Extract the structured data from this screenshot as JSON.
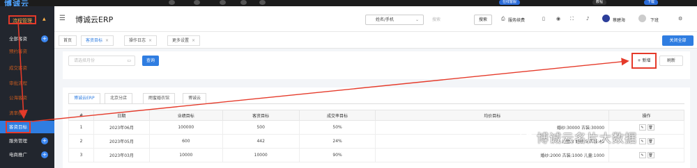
{
  "topbar": {
    "logo": "博诚云",
    "buttons": [
      "在线客服",
      "教程",
      "下载"
    ]
  },
  "sidebar": {
    "group": "流程管理",
    "items": [
      {
        "label": "全部客资",
        "plus": true
      },
      {
        "label": "预约客资"
      },
      {
        "label": "成交客资"
      },
      {
        "label": "审批流程"
      },
      {
        "label": "公海客资"
      },
      {
        "label": "清率统计"
      },
      {
        "label": "客资目标",
        "active": true
      },
      {
        "label": "服务管理",
        "plus": true
      },
      {
        "label": "电商推广",
        "plus": true
      }
    ]
  },
  "header": {
    "brand": "博诚云ERP",
    "select": "姓名/手机",
    "search_placeholder": "搜索",
    "search_button": "搜索",
    "service": "服务续费",
    "user": "蔡碧海",
    "logout": "下班"
  },
  "tabs": [
    {
      "label": "首页"
    },
    {
      "label": "客资目标",
      "active": true,
      "closable": true
    },
    {
      "label": "操作日志",
      "closable": true
    },
    {
      "label": "更多设置",
      "closable": true
    }
  ],
  "close_all": "关闭全部",
  "filter": {
    "month_placeholder": "请选择月份",
    "query": "查询",
    "add": "+ 新增",
    "refresh": "刷新"
  },
  "store_tabs": [
    "博诚云ERP",
    "北京分店",
    "雨蜜婚衣馆",
    "博诚云"
  ],
  "table": {
    "columns": [
      "#",
      "日期",
      "业绩目标",
      "客资目标",
      "成交率目标",
      "均价目标",
      "操作"
    ],
    "rows": [
      {
        "idx": "1",
        "date": "2023年06月",
        "perf": "100000",
        "leads": "500",
        "rate": "50%",
        "avg": "婚纱:30000 古装:30000"
      },
      {
        "idx": "2",
        "date": "2023年05月",
        "perf": "600",
        "leads": "442",
        "rate": "24%",
        "avg": "儿童:2 婚纱:5 古装:43"
      },
      {
        "idx": "3",
        "date": "2023年03月",
        "perf": "10000",
        "leads": "10000",
        "rate": "90%",
        "avg": "婚纱:2000 古装:1000 儿童:1000"
      }
    ]
  },
  "watermark": "博诚云名片大数据",
  "colors": {
    "primary": "#2f7de1",
    "sidebar": "#22262e",
    "highlight": "#e53a2a",
    "sidebar_text": "#c65a1f"
  }
}
